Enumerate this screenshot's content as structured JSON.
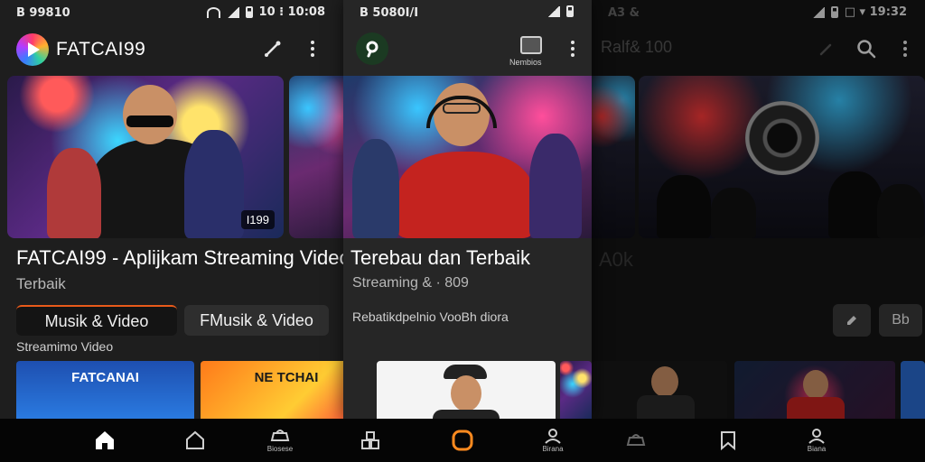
{
  "panels": [
    {
      "status": {
        "left": "B 99810",
        "right": "10 ⁝ 10:08"
      },
      "app_name": "FATCAI99",
      "hero_badge": "I199",
      "title": "FATCAI99 - Aplijkam Streaming Video",
      "subtitle": "Terbaik",
      "chips": [
        "Musik & Video",
        "FMusik & Video"
      ],
      "section_label": "Streamimo Video",
      "cards": [
        "FATCANAI",
        "NE TCHAI"
      ]
    },
    {
      "status": {
        "left": "B 5080I/I"
      },
      "action_label": "Nembios",
      "title": "Terebau dan Terbaik",
      "subtitle": "Streaming & · 809",
      "description": "Rebatikdpelnio VooBh diora"
    },
    {
      "status": {
        "left": "A3 &",
        "right": "□ ▾ 19:32"
      },
      "header_faded": "Ralf& 100",
      "title_faded": "A0k",
      "buttons": [
        "Bb"
      ]
    }
  ],
  "bottom_nav": [
    {
      "icon": "home-icon",
      "label": ""
    },
    {
      "icon": "home-outline-icon",
      "label": ""
    },
    {
      "icon": "library-icon",
      "label": "Biosese"
    },
    {
      "icon": "grid-icon",
      "label": ""
    },
    {
      "icon": "shorts-icon",
      "label": ""
    },
    {
      "icon": "profile-icon",
      "label": "Birana"
    },
    {
      "icon": "library-icon",
      "label": ""
    },
    {
      "icon": "bookmark-icon",
      "label": ""
    },
    {
      "icon": "profile-icon",
      "label": "Biana"
    }
  ],
  "colors": {
    "accent": "#e85a1a",
    "background": "#1e1e1e",
    "active_nav": "#ff8a1f"
  }
}
